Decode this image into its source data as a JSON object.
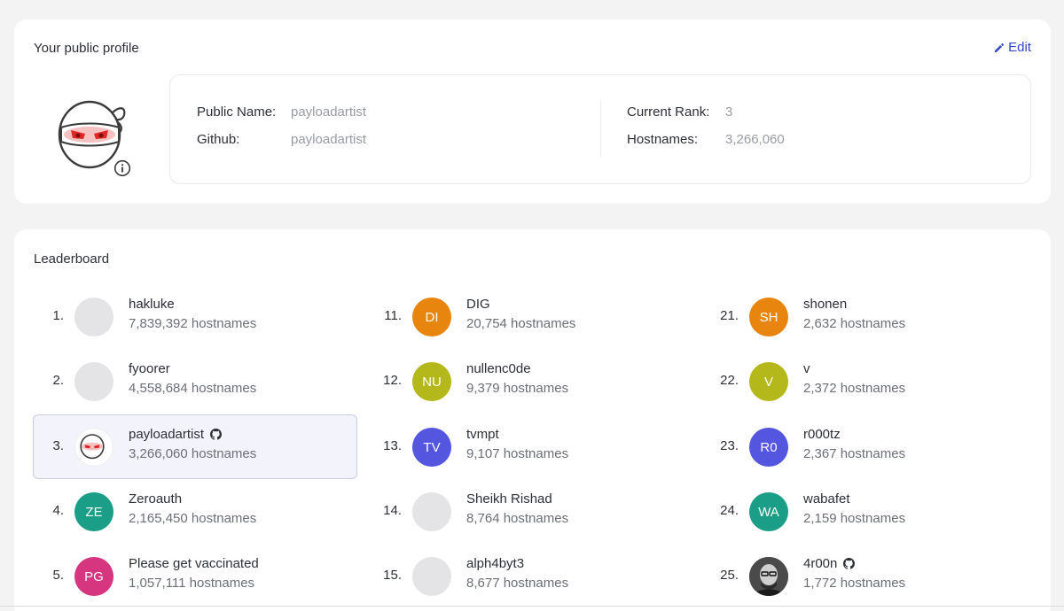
{
  "profile": {
    "title": "Your public profile",
    "edit_label": "Edit",
    "public_name_label": "Public Name:",
    "public_name": "payloadartist",
    "github_label": "Github:",
    "github": "payloadartist",
    "current_rank_label": "Current Rank:",
    "current_rank": "3",
    "hostnames_label": "Hostnames:",
    "hostnames": "3,266,060"
  },
  "leaderboard": {
    "title": "Leaderboard",
    "entries": [
      {
        "rank": "1.",
        "name": "hakluke",
        "count": "7,839,392 hostnames",
        "initials": "",
        "avatar": "blank"
      },
      {
        "rank": "2.",
        "name": "fyoorer",
        "count": "4,558,684 hostnames",
        "initials": "",
        "avatar": "blank"
      },
      {
        "rank": "3.",
        "name": "payloadartist",
        "count": "3,266,060 hostnames",
        "initials": "",
        "avatar": "ninja-icon",
        "github": true,
        "highlight": true
      },
      {
        "rank": "4.",
        "name": "Zeroauth",
        "count": "2,165,450 hostnames",
        "initials": "ZE",
        "color": "#1a9e88"
      },
      {
        "rank": "5.",
        "name": "Please get vaccinated",
        "count": "1,057,111 hostnames",
        "initials": "PG",
        "color": "#d6357f"
      },
      {
        "rank": "11.",
        "name": "DIG",
        "count": "20,754 hostnames",
        "initials": "DI",
        "color": "#e8850e"
      },
      {
        "rank": "12.",
        "name": "nullenc0de",
        "count": "9,379 hostnames",
        "initials": "NU",
        "color": "#b5b81a"
      },
      {
        "rank": "13.",
        "name": "tvmpt",
        "count": "9,107 hostnames",
        "initials": "TV",
        "color": "#5556e0"
      },
      {
        "rank": "14.",
        "name": "Sheikh Rishad",
        "count": "8,764 hostnames",
        "initials": "",
        "avatar": "blank"
      },
      {
        "rank": "15.",
        "name": "alph4byt3",
        "count": "8,677 hostnames",
        "initials": "",
        "avatar": "blank"
      },
      {
        "rank": "21.",
        "name": "shonen",
        "count": "2,632 hostnames",
        "initials": "SH",
        "color": "#e8850e"
      },
      {
        "rank": "22.",
        "name": "v",
        "count": "2,372 hostnames",
        "initials": "V",
        "color": "#b5b81a"
      },
      {
        "rank": "23.",
        "name": "r000tz",
        "count": "2,367 hostnames",
        "initials": "R0",
        "color": "#5556e0"
      },
      {
        "rank": "24.",
        "name": "wabafet",
        "count": "2,159 hostnames",
        "initials": "WA",
        "color": "#1a9e88"
      },
      {
        "rank": "25.",
        "name": "4r00n",
        "count": "1,772 hostnames",
        "initials": "",
        "avatar": "person-photo",
        "github": true
      }
    ]
  }
}
